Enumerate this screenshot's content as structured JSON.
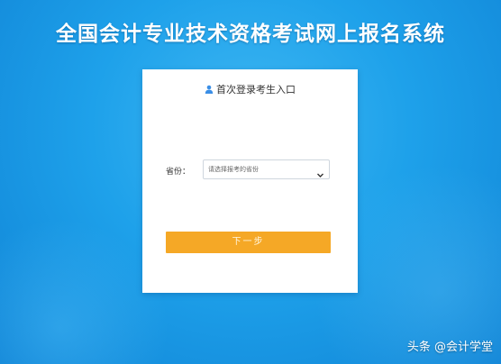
{
  "page": {
    "title": "全国会计专业技术资格考试网上报名系统"
  },
  "card": {
    "header": {
      "icon": "user-icon",
      "text": "首次登录考生入口"
    },
    "province": {
      "label": "省份：",
      "placeholder": "请选择报考的省份",
      "icon": "chevron-down-icon"
    },
    "next_button": {
      "label": "下一步"
    }
  },
  "watermark": {
    "text": "头条 @会计学堂"
  },
  "colors": {
    "background": "#1ea1ea",
    "button": "#f5a826",
    "card": "#ffffff",
    "user_icon": "#3a8ee6"
  }
}
